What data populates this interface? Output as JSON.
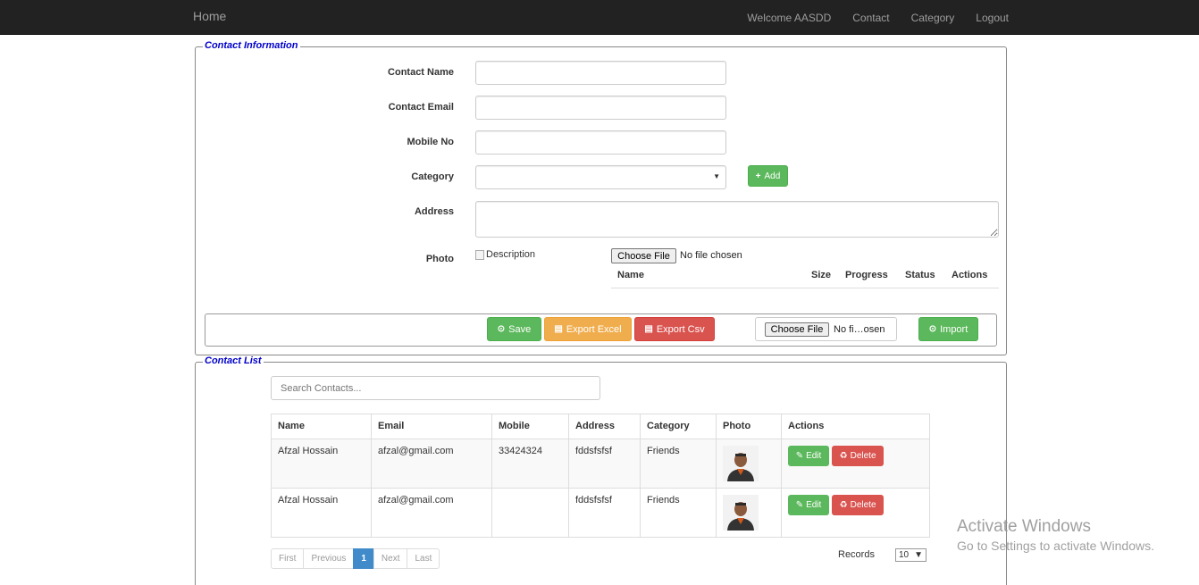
{
  "navbar": {
    "brand": "Home",
    "welcome": "Welcome AASDD",
    "items": [
      "Contact",
      "Category",
      "Logout"
    ]
  },
  "contact_info": {
    "legend": "Contact Information",
    "fields": {
      "name_label": "Contact Name",
      "name_value": "",
      "email_label": "Contact Email",
      "email_value": "",
      "mobile_label": "Mobile No",
      "mobile_value": "",
      "category_label": "Category",
      "category_value": "",
      "address_label": "Address",
      "address_value": "",
      "photo_label": "Photo",
      "photo_alt": "Description"
    },
    "add_button": "Add",
    "file_input": {
      "button": "Choose File",
      "status": "No file chosen"
    },
    "upload_columns": [
      "Name",
      "Size",
      "Progress",
      "Status",
      "Actions"
    ],
    "toolbar": {
      "save": "Save",
      "export_excel": "Export Excel",
      "export_csv": "Export Csv",
      "import_file_button": "Choose File",
      "import_file_status": "No fi…osen",
      "import": "Import"
    }
  },
  "contact_list": {
    "legend": "Contact List",
    "search_placeholder": "Search Contacts...",
    "columns": [
      "Name",
      "Email",
      "Mobile",
      "Address",
      "Category",
      "Photo",
      "Actions"
    ],
    "rows": [
      {
        "name": "Afzal Hossain",
        "email": "afzal@gmail.com",
        "mobile": "33424324",
        "address": "fddsfsfsf",
        "category": "Friends"
      },
      {
        "name": "Afzal Hossain",
        "email": "afzal@gmail.com",
        "mobile": "",
        "address": "fddsfsfsf",
        "category": "Friends"
      }
    ],
    "row_actions": {
      "edit": "Edit",
      "delete": "Delete"
    },
    "pager": [
      "First",
      "Previous",
      "1",
      "Next",
      "Last"
    ],
    "pager_active": "1",
    "records_label": "Records",
    "records_value": "10"
  },
  "watermark": {
    "line1": "Activate Windows",
    "line2": "Go to Settings to activate Windows."
  },
  "colors": {
    "success": "#5cb85c",
    "warning": "#f0ad4e",
    "danger": "#d9534f",
    "primary": "#428bca",
    "legend": "#0000cc",
    "navbar": "#222222"
  }
}
